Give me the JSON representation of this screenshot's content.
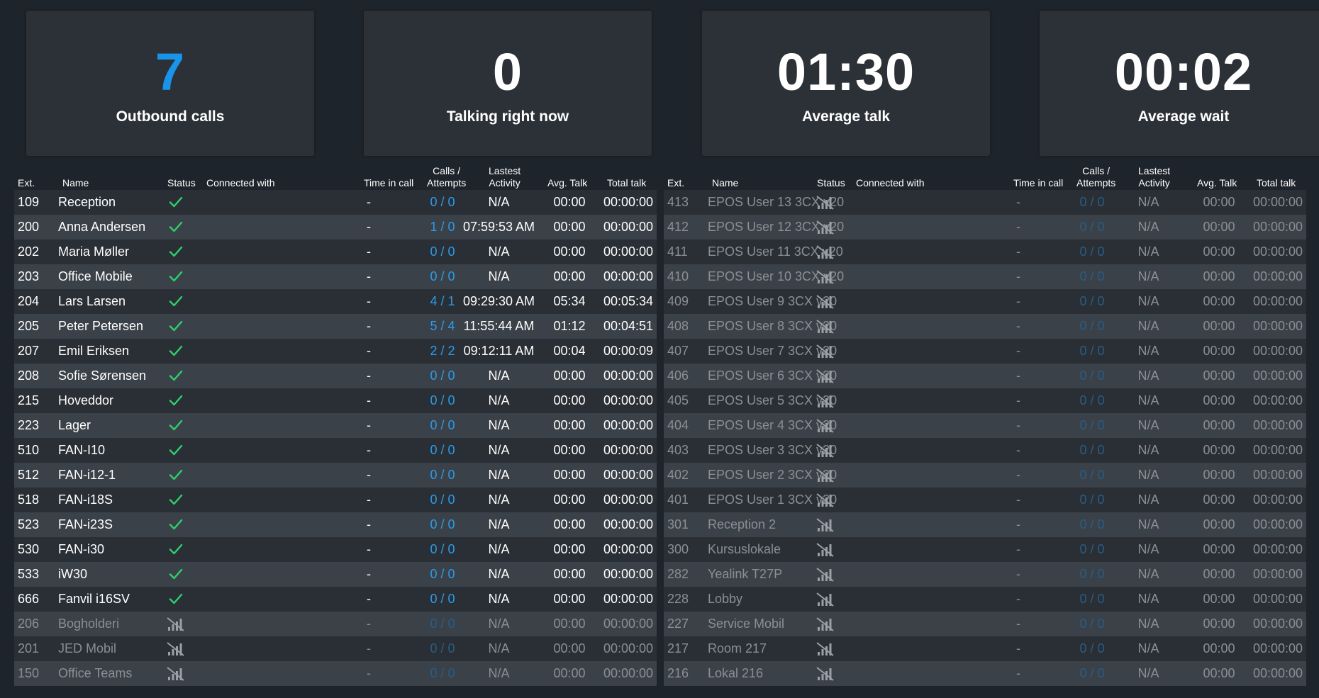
{
  "stats": [
    {
      "value": "7",
      "label": "Outbound calls",
      "color": "#1a93ea"
    },
    {
      "value": "0",
      "label": "Talking right now",
      "color": "#ffffff"
    },
    {
      "value": "01:30",
      "label": "Average talk",
      "color": "#ffffff"
    },
    {
      "value": "00:02",
      "label": "Average wait",
      "color": "#ffffff"
    }
  ],
  "columns": {
    "ext": "Ext.",
    "name": "Name",
    "status": "Status",
    "connected": "Connected with",
    "time_in_call": "Time in call",
    "calls_line1": "Calls /",
    "calls_line2": "Attempts",
    "last_line1": "Lastest",
    "last_line2": "Activity",
    "avg": "Avg. Talk",
    "total": "Total talk"
  },
  "status_icons": {
    "online": "check-icon",
    "offline": "signal-off-icon"
  },
  "colors": {
    "online_check": "#2fcf6d",
    "calls_link": "#2b9bea",
    "offline_text": "#8a8f95"
  },
  "left_rows": [
    {
      "ext": "109",
      "name": "Reception",
      "status": "online",
      "time_in_call": "-",
      "calls": "0 / 0",
      "last": "N/A",
      "avg": "00:00",
      "total": "00:00:00"
    },
    {
      "ext": "200",
      "name": "Anna Andersen",
      "status": "online",
      "time_in_call": "-",
      "calls": "1 / 0",
      "last": "07:59:53 AM",
      "avg": "00:00",
      "total": "00:00:00"
    },
    {
      "ext": "202",
      "name": "Maria Møller",
      "status": "online",
      "time_in_call": "-",
      "calls": "0 / 0",
      "last": "N/A",
      "avg": "00:00",
      "total": "00:00:00"
    },
    {
      "ext": "203",
      "name": "Office Mobile",
      "status": "online",
      "time_in_call": "-",
      "calls": "0 / 0",
      "last": "N/A",
      "avg": "00:00",
      "total": "00:00:00"
    },
    {
      "ext": "204",
      "name": "Lars Larsen",
      "status": "online",
      "time_in_call": "-",
      "calls": "4 / 1",
      "last": "09:29:30 AM",
      "avg": "05:34",
      "total": "00:05:34"
    },
    {
      "ext": "205",
      "name": "Peter Petersen",
      "status": "online",
      "time_in_call": "-",
      "calls": "5 / 4",
      "last": "11:55:44 AM",
      "avg": "01:12",
      "total": "00:04:51"
    },
    {
      "ext": "207",
      "name": "Emil Eriksen",
      "status": "online",
      "time_in_call": "-",
      "calls": "2 / 2",
      "last": "09:12:11 AM",
      "avg": "00:04",
      "total": "00:00:09"
    },
    {
      "ext": "208",
      "name": "Sofie Sørensen",
      "status": "online",
      "time_in_call": "-",
      "calls": "0 / 0",
      "last": "N/A",
      "avg": "00:00",
      "total": "00:00:00"
    },
    {
      "ext": "215",
      "name": "Hoveddor",
      "status": "online",
      "time_in_call": "-",
      "calls": "0 / 0",
      "last": "N/A",
      "avg": "00:00",
      "total": "00:00:00"
    },
    {
      "ext": "223",
      "name": "Lager",
      "status": "online",
      "time_in_call": "-",
      "calls": "0 / 0",
      "last": "N/A",
      "avg": "00:00",
      "total": "00:00:00"
    },
    {
      "ext": "510",
      "name": "FAN-I10",
      "status": "online",
      "time_in_call": "-",
      "calls": "0 / 0",
      "last": "N/A",
      "avg": "00:00",
      "total": "00:00:00"
    },
    {
      "ext": "512",
      "name": "FAN-i12-1",
      "status": "online",
      "time_in_call": "-",
      "calls": "0 / 0",
      "last": "N/A",
      "avg": "00:00",
      "total": "00:00:00"
    },
    {
      "ext": "518",
      "name": "FAN-i18S",
      "status": "online",
      "time_in_call": "-",
      "calls": "0 / 0",
      "last": "N/A",
      "avg": "00:00",
      "total": "00:00:00"
    },
    {
      "ext": "523",
      "name": "FAN-i23S",
      "status": "online",
      "time_in_call": "-",
      "calls": "0 / 0",
      "last": "N/A",
      "avg": "00:00",
      "total": "00:00:00"
    },
    {
      "ext": "530",
      "name": "FAN-i30",
      "status": "online",
      "time_in_call": "-",
      "calls": "0 / 0",
      "last": "N/A",
      "avg": "00:00",
      "total": "00:00:00"
    },
    {
      "ext": "533",
      "name": "iW30",
      "status": "online",
      "time_in_call": "-",
      "calls": "0 / 0",
      "last": "N/A",
      "avg": "00:00",
      "total": "00:00:00"
    },
    {
      "ext": "666",
      "name": "Fanvil i16SV",
      "status": "online",
      "time_in_call": "-",
      "calls": "0 / 0",
      "last": "N/A",
      "avg": "00:00",
      "total": "00:00:00"
    },
    {
      "ext": "206",
      "name": "Bogholderi",
      "status": "offline",
      "time_in_call": "-",
      "calls": "0 / 0",
      "last": "N/A",
      "avg": "00:00",
      "total": "00:00:00"
    },
    {
      "ext": "201",
      "name": "JED Mobil",
      "status": "offline",
      "time_in_call": "-",
      "calls": "0 / 0",
      "last": "N/A",
      "avg": "00:00",
      "total": "00:00:00"
    },
    {
      "ext": "150",
      "name": "Office Teams",
      "status": "offline",
      "time_in_call": "-",
      "calls": "0 / 0",
      "last": "N/A",
      "avg": "00:00",
      "total": "00:00:00"
    }
  ],
  "right_rows": [
    {
      "ext": "413",
      "name": "EPOS User 13 3CX v20",
      "status": "offline",
      "time_in_call": "-",
      "calls": "0 / 0",
      "last": "N/A",
      "avg": "00:00",
      "total": "00:00:00"
    },
    {
      "ext": "412",
      "name": "EPOS User 12 3CX v20",
      "status": "offline",
      "time_in_call": "-",
      "calls": "0 / 0",
      "last": "N/A",
      "avg": "00:00",
      "total": "00:00:00"
    },
    {
      "ext": "411",
      "name": "EPOS User 11 3CX v20",
      "status": "offline",
      "time_in_call": "-",
      "calls": "0 / 0",
      "last": "N/A",
      "avg": "00:00",
      "total": "00:00:00"
    },
    {
      "ext": "410",
      "name": "EPOS User 10 3CX v20",
      "status": "offline",
      "time_in_call": "-",
      "calls": "0 / 0",
      "last": "N/A",
      "avg": "00:00",
      "total": "00:00:00"
    },
    {
      "ext": "409",
      "name": "EPOS User 9 3CX v20",
      "status": "offline",
      "time_in_call": "-",
      "calls": "0 / 0",
      "last": "N/A",
      "avg": "00:00",
      "total": "00:00:00"
    },
    {
      "ext": "408",
      "name": "EPOS User 8 3CX v20",
      "status": "offline",
      "time_in_call": "-",
      "calls": "0 / 0",
      "last": "N/A",
      "avg": "00:00",
      "total": "00:00:00"
    },
    {
      "ext": "407",
      "name": "EPOS User 7 3CX v20",
      "status": "offline",
      "time_in_call": "-",
      "calls": "0 / 0",
      "last": "N/A",
      "avg": "00:00",
      "total": "00:00:00"
    },
    {
      "ext": "406",
      "name": "EPOS User 6 3CX v20",
      "status": "offline",
      "time_in_call": "-",
      "calls": "0 / 0",
      "last": "N/A",
      "avg": "00:00",
      "total": "00:00:00"
    },
    {
      "ext": "405",
      "name": "EPOS User 5 3CX v20",
      "status": "offline",
      "time_in_call": "-",
      "calls": "0 / 0",
      "last": "N/A",
      "avg": "00:00",
      "total": "00:00:00"
    },
    {
      "ext": "404",
      "name": "EPOS User 4 3CX v20",
      "status": "offline",
      "time_in_call": "-",
      "calls": "0 / 0",
      "last": "N/A",
      "avg": "00:00",
      "total": "00:00:00"
    },
    {
      "ext": "403",
      "name": "EPOS User 3 3CX v20",
      "status": "offline",
      "time_in_call": "-",
      "calls": "0 / 0",
      "last": "N/A",
      "avg": "00:00",
      "total": "00:00:00"
    },
    {
      "ext": "402",
      "name": "EPOS User 2 3CX v20",
      "status": "offline",
      "time_in_call": "-",
      "calls": "0 / 0",
      "last": "N/A",
      "avg": "00:00",
      "total": "00:00:00"
    },
    {
      "ext": "401",
      "name": "EPOS User 1 3CX v20",
      "status": "offline",
      "time_in_call": "-",
      "calls": "0 / 0",
      "last": "N/A",
      "avg": "00:00",
      "total": "00:00:00"
    },
    {
      "ext": "301",
      "name": "Reception 2",
      "status": "offline",
      "time_in_call": "-",
      "calls": "0 / 0",
      "last": "N/A",
      "avg": "00:00",
      "total": "00:00:00"
    },
    {
      "ext": "300",
      "name": "Kursuslokale",
      "status": "offline",
      "time_in_call": "-",
      "calls": "0 / 0",
      "last": "N/A",
      "avg": "00:00",
      "total": "00:00:00"
    },
    {
      "ext": "282",
      "name": "Yealink T27P",
      "status": "offline",
      "time_in_call": "-",
      "calls": "0 / 0",
      "last": "N/A",
      "avg": "00:00",
      "total": "00:00:00"
    },
    {
      "ext": "228",
      "name": "Lobby",
      "status": "offline",
      "time_in_call": "-",
      "calls": "0 / 0",
      "last": "N/A",
      "avg": "00:00",
      "total": "00:00:00"
    },
    {
      "ext": "227",
      "name": "Service Mobil",
      "status": "offline",
      "time_in_call": "-",
      "calls": "0 / 0",
      "last": "N/A",
      "avg": "00:00",
      "total": "00:00:00"
    },
    {
      "ext": "217",
      "name": "Room 217",
      "status": "offline",
      "time_in_call": "-",
      "calls": "0 / 0",
      "last": "N/A",
      "avg": "00:00",
      "total": "00:00:00"
    },
    {
      "ext": "216",
      "name": "Lokal 216",
      "status": "offline",
      "time_in_call": "-",
      "calls": "0 / 0",
      "last": "N/A",
      "avg": "00:00",
      "total": "00:00:00"
    }
  ]
}
